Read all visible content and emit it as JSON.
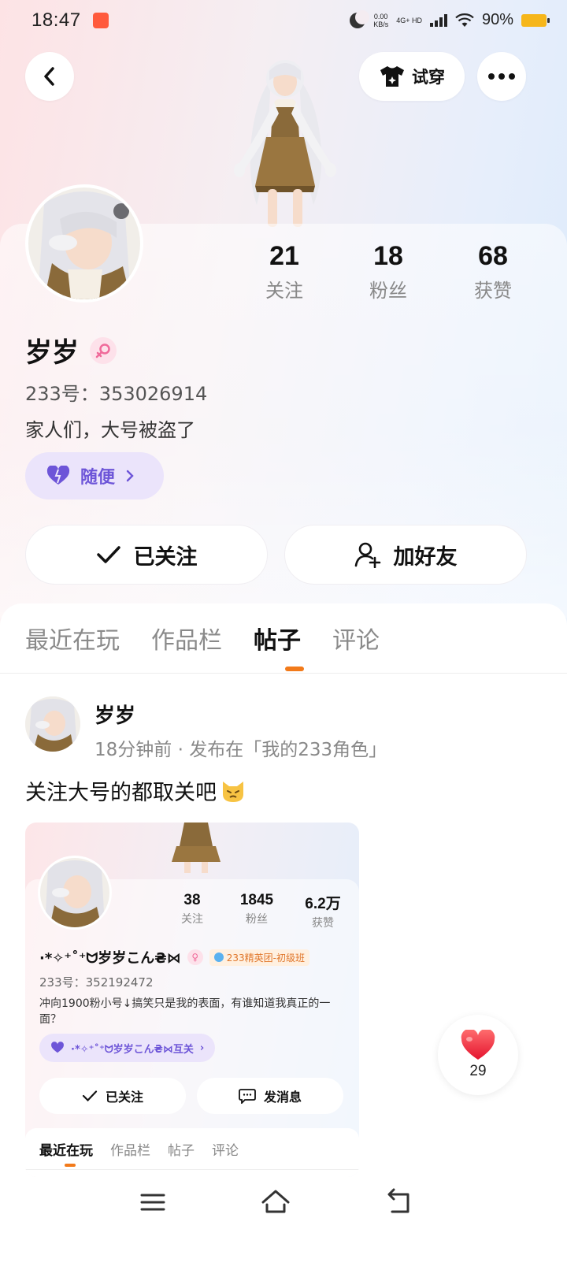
{
  "status_bar": {
    "time": "18:47",
    "speed_value": "0.00",
    "speed_unit": "KB/s",
    "network": "4G+ HD",
    "battery": "90%"
  },
  "header": {
    "tryon_label": "试穿"
  },
  "profile": {
    "name": "岁岁",
    "uid": "233号：353026914",
    "bio": "家人们，大号被盗了",
    "tag_label": "随便",
    "stats": [
      {
        "value": "21",
        "label": "关注"
      },
      {
        "value": "18",
        "label": "粉丝"
      },
      {
        "value": "68",
        "label": "获赞"
      }
    ],
    "follow_label": "已关注",
    "add_friend_label": "加好友"
  },
  "tabs": [
    {
      "label": "最近在玩"
    },
    {
      "label": "作品栏"
    },
    {
      "label": "帖子"
    },
    {
      "label": "评论"
    }
  ],
  "post": {
    "author": "岁岁",
    "meta": "18分钟前 · 发布在「我的233角色」",
    "text": "关注大号的都取关吧",
    "likes": "29"
  },
  "embedded_profile": {
    "name": "·*✧⁺˚⁺ᗢ岁岁こん₴⋈",
    "badge": "233精英团-初级班",
    "uid": "233号：352192472",
    "bio": "冲向1900粉小号↓搞笑只是我的表面，有谁知道我真正的一面？",
    "tag": "·*✧⁺˚⁺ᗢ岁岁こん₴⋈互关",
    "stats": [
      {
        "value": "38",
        "label": "关注"
      },
      {
        "value": "1845",
        "label": "粉丝"
      },
      {
        "value": "6.2万",
        "label": "获赞"
      }
    ],
    "follow_label": "已关注",
    "message_label": "发消息",
    "tabs": [
      "最近在玩",
      "作品栏",
      "帖子",
      "评论"
    ]
  },
  "colors": {
    "accent_orange": "#f27a1a",
    "tag_purple": "#6d55d8",
    "like_red": "#f23a4a"
  }
}
